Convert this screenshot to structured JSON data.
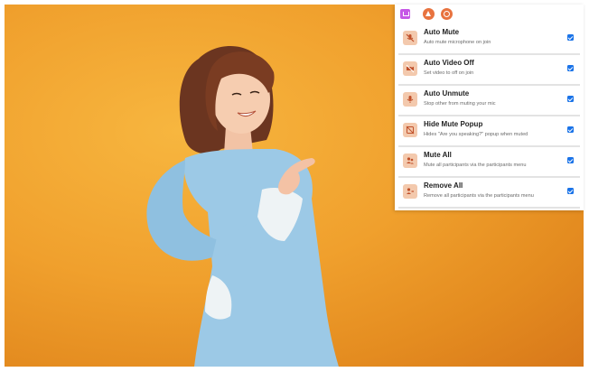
{
  "toolbar": {
    "icons": [
      "extension-icon",
      "warning-icon",
      "circle-icon"
    ]
  },
  "settings": [
    {
      "title": "Auto Mute",
      "desc": "Auto mute microphone on join",
      "icon": "mic-off-icon",
      "checked": true
    },
    {
      "title": "Auto Video Off",
      "desc": "Set video to off on join",
      "icon": "video-off-icon",
      "checked": true
    },
    {
      "title": "Auto Unmute",
      "desc": "Stop other from muting your mic",
      "icon": "mic-icon",
      "checked": true
    },
    {
      "title": "Hide Mute Popup",
      "desc": "Hides \"Are you speaking?\" popup when muted",
      "icon": "popup-off-icon",
      "checked": true
    },
    {
      "title": "Mute All",
      "desc": "Mute all participants via the participants menu",
      "icon": "people-mute-icon",
      "checked": true
    },
    {
      "title": "Remove All",
      "desc": "Remove all participants via the participants menu",
      "icon": "people-remove-icon",
      "checked": true
    }
  ],
  "colors": {
    "background": "#f0a02d",
    "accent": "#1a73e8",
    "icon_bg": "#f3c9ad",
    "icon_fg": "#c0502a"
  }
}
